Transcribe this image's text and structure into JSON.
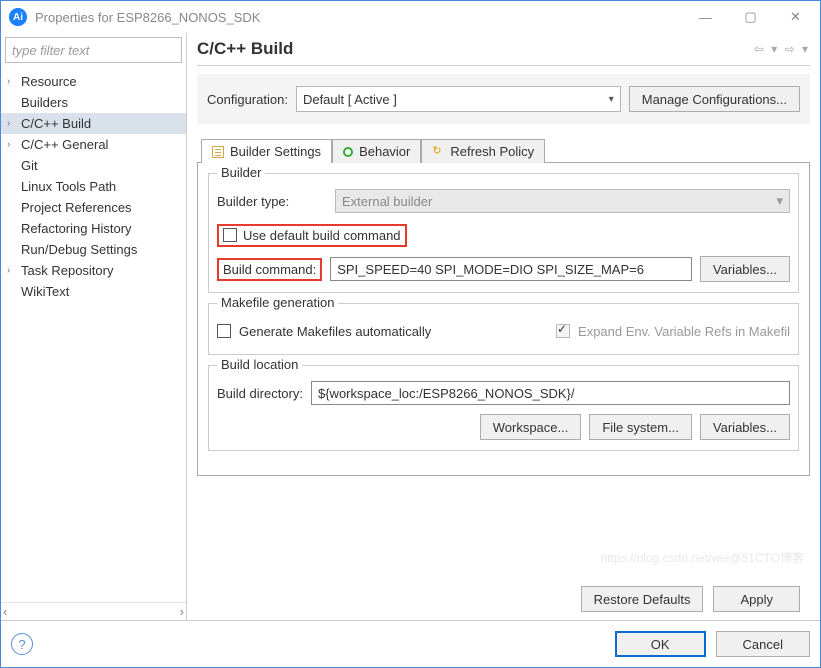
{
  "window": {
    "title": "Properties for ESP8266_NONOS_SDK"
  },
  "sidebar": {
    "filter_placeholder": "type filter text",
    "items": [
      {
        "label": "Resource",
        "expandable": true
      },
      {
        "label": "Builders",
        "expandable": false
      },
      {
        "label": "C/C++ Build",
        "expandable": true,
        "selected": true
      },
      {
        "label": "C/C++ General",
        "expandable": true
      },
      {
        "label": "Git",
        "expandable": false
      },
      {
        "label": "Linux Tools Path",
        "expandable": false
      },
      {
        "label": "Project References",
        "expandable": false
      },
      {
        "label": "Refactoring History",
        "expandable": false
      },
      {
        "label": "Run/Debug Settings",
        "expandable": false
      },
      {
        "label": "Task Repository",
        "expandable": true
      },
      {
        "label": "WikiText",
        "expandable": false
      }
    ]
  },
  "header": {
    "title": "C/C++ Build"
  },
  "config": {
    "label": "Configuration:",
    "value": "Default  [ Active ]",
    "manage": "Manage Configurations..."
  },
  "tabs": [
    {
      "label": "Builder Settings",
      "icon": "file",
      "active": true
    },
    {
      "label": "Behavior",
      "icon": "dot"
    },
    {
      "label": "Refresh Policy",
      "icon": "ref"
    }
  ],
  "builder": {
    "legend": "Builder",
    "type_label": "Builder type:",
    "type_value": "External builder",
    "use_default_label": "Use default build command",
    "use_default_checked": false,
    "command_label": "Build command:",
    "command_value": "SPI_SPEED=40 SPI_MODE=DIO SPI_SIZE_MAP=6",
    "variables_btn": "Variables..."
  },
  "makefile": {
    "legend": "Makefile generation",
    "generate_label": "Generate Makefiles automatically",
    "generate_checked": false,
    "expand_label": "Expand Env. Variable Refs in Makefil",
    "expand_checked": true
  },
  "location": {
    "legend": "Build location",
    "dir_label": "Build directory:",
    "dir_value": "${workspace_loc:/ESP8266_NONOS_SDK}/",
    "workspace_btn": "Workspace...",
    "filesystem_btn": "File system...",
    "variables_btn": "Variables..."
  },
  "footer": {
    "restore": "Restore Defaults",
    "apply": "Apply",
    "ok": "OK",
    "cancel": "Cancel"
  },
  "watermark": "https://blog.csdn.net/wei@51CTO博客"
}
